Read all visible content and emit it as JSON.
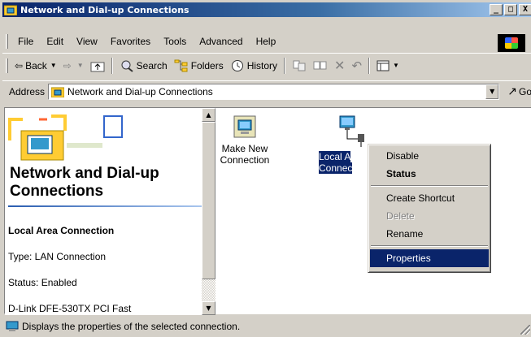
{
  "window": {
    "title": "Network and Dial-up Connections",
    "minimize": "_",
    "maximize": "□",
    "close": "X"
  },
  "menu": {
    "items": [
      "File",
      "Edit",
      "View",
      "Favorites",
      "Tools",
      "Advanced",
      "Help"
    ]
  },
  "toolbar": {
    "back": "Back",
    "search": "Search",
    "folders": "Folders",
    "history": "History"
  },
  "address": {
    "label": "Address",
    "value": "Network and Dial-up Connections",
    "go": "Go"
  },
  "left_panel": {
    "title": "Network and Dial-up Connections",
    "heading": "Local Area Connection",
    "type": "Type: LAN Connection",
    "status": "Status: Enabled",
    "device": "D-Link DFE-530TX PCI Fast"
  },
  "icons": [
    {
      "label_line1": "Make New",
      "label_line2": "Connection"
    },
    {
      "label_line1": "Local A",
      "label_line2": "Connec"
    }
  ],
  "context_menu": {
    "items": [
      "Disable",
      "Status",
      "Create Shortcut",
      "Delete",
      "Rename",
      "Properties"
    ]
  },
  "status_bar": {
    "text": "Displays the properties of the selected connection."
  },
  "colors": {
    "title_start": "#0a246a",
    "title_end": "#a6caf0",
    "highlight": "#0a246a",
    "face": "#d4d0c8"
  }
}
